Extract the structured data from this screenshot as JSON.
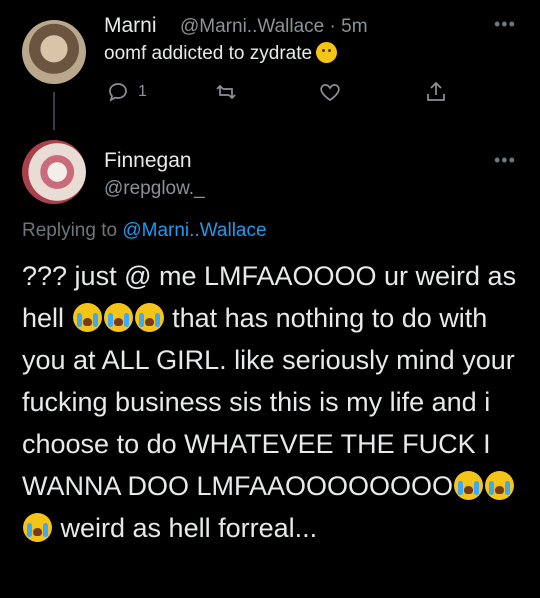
{
  "tweet1": {
    "name": "Marni",
    "handle": "@Marni..Wallace",
    "separator": "·",
    "time": "5m",
    "text": "oomf addicted to zydrate",
    "emoji": "confused-face-emoji",
    "reply_count": "1"
  },
  "tweet2": {
    "name": "Finnegan",
    "handle": "@repglow._",
    "replying_prefix": "Replying to",
    "replying_to": "@Marni..Wallace",
    "text_part1": "??? just @ me LMFAAOOOO ur weird as hell",
    "text_part2": "that has nothing to do with you at ALL GIRL. like seriously mind your fucking business sis this is my life and i choose to do WHATEVEE THE FUCK I WANNA DOO LMFAAOOOOOOOO",
    "text_part3": "weird as hell forreal...",
    "emoji": "loudly-crying-face-emoji"
  },
  "more_icon": "•••",
  "colors": {
    "background": "#000000",
    "text": "#e7e9ea",
    "muted": "#8b9298",
    "link": "#1d9bf0"
  }
}
